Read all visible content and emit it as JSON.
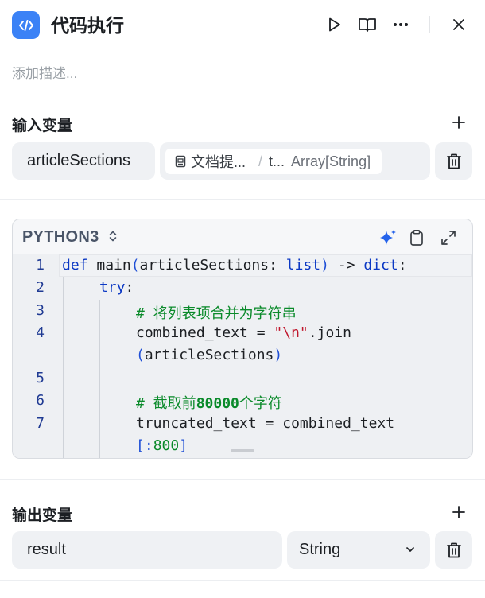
{
  "header": {
    "title": "代码执行",
    "description_placeholder": "添加描述..."
  },
  "input_section": {
    "title": "输入变量",
    "variables": [
      {
        "name": "articleSections",
        "ref_source": "文档提...",
        "ref_separator": "/",
        "ref_field": "t...",
        "ref_type": "Array[String]"
      }
    ]
  },
  "code_editor": {
    "language": "PYTHON3",
    "line_numbers": [
      "1",
      "2",
      "3",
      "4",
      "",
      "5",
      "6",
      "7",
      ""
    ],
    "lines": {
      "l1_def": "def",
      "l1_name": " main",
      "l1_open": "(",
      "l1_param": "articleSections: ",
      "l1_list": "list",
      "l1_close": ")",
      "l1_arrow": " -> ",
      "l1_dict": "dict",
      "l1_colon": ":",
      "l2_try": "try",
      "l2_colon": ":",
      "l3_comment": "# 将列表项合并为字符串",
      "l4_a": "combined_text = ",
      "l4_str_q1": "\"",
      "l4_str_esc": "\\n",
      "l4_str_q2": "\"",
      "l4_b": ".join",
      "l4w_open": "(",
      "l4w_arg": "articleSections",
      "l4w_close": ")",
      "l6_comment_a": "# 截取前",
      "l6_comment_num": "80000",
      "l6_comment_b": "个字符",
      "l7_a": "truncated_text = combined_text",
      "l7w_a": "[:",
      "l7w_num": "800",
      "l7w_b": "]"
    }
  },
  "output_section": {
    "title": "输出变量",
    "variables": [
      {
        "name": "result",
        "type": "String"
      }
    ]
  },
  "colors": {
    "accent": "#3b82f6",
    "sparkle": "#2563eb",
    "keyword": "#0b38c4",
    "string": "#c0162c",
    "comment": "#0a8a2a"
  }
}
